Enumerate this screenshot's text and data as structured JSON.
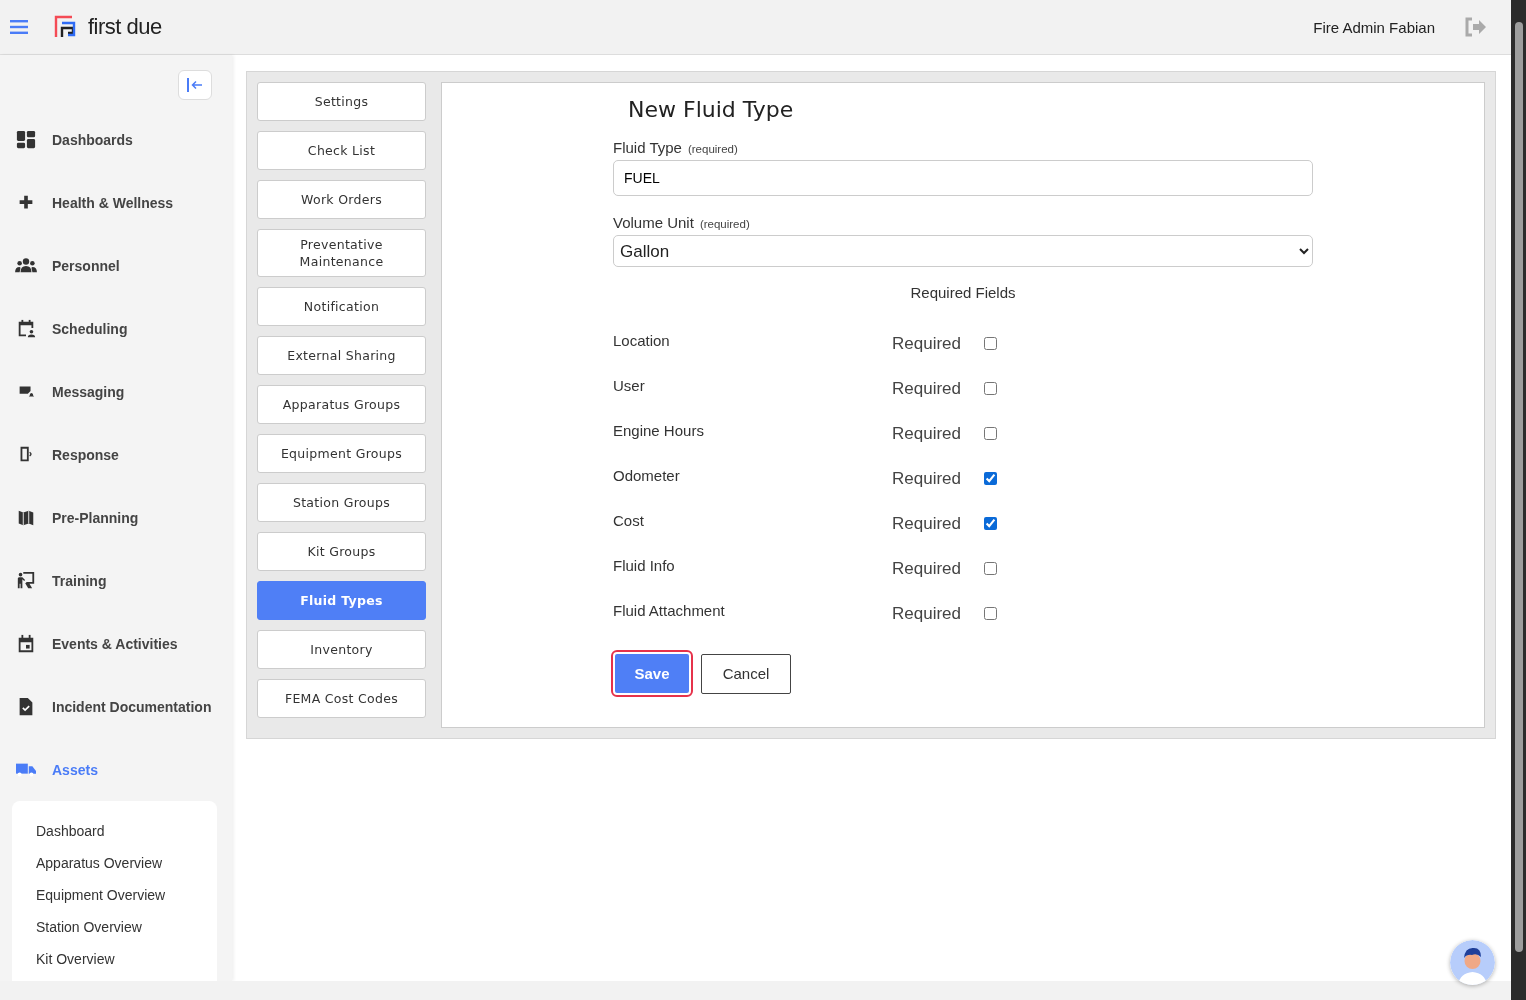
{
  "header": {
    "brand": "first due",
    "user": "Fire Admin Fabian"
  },
  "sidebar": {
    "items": [
      {
        "label": "Dashboards",
        "selected": false
      },
      {
        "label": "Health & Wellness",
        "selected": false
      },
      {
        "label": "Personnel",
        "selected": false
      },
      {
        "label": "Scheduling",
        "selected": false
      },
      {
        "label": "Messaging",
        "selected": false
      },
      {
        "label": "Response",
        "selected": false
      },
      {
        "label": "Pre-Planning",
        "selected": false
      },
      {
        "label": "Training",
        "selected": false
      },
      {
        "label": "Events & Activities",
        "selected": false
      },
      {
        "label": "Incident Documentation",
        "selected": false
      },
      {
        "label": "Assets",
        "selected": true
      }
    ],
    "subitems": [
      "Dashboard",
      "Apparatus Overview",
      "Equipment Overview",
      "Station Overview",
      "Kit Overview"
    ]
  },
  "settings_nav": [
    {
      "label": "Settings",
      "selected": false
    },
    {
      "label": "Check List",
      "selected": false
    },
    {
      "label": "Work Orders",
      "selected": false
    },
    {
      "label": "Preventative Maintenance",
      "selected": false
    },
    {
      "label": "Notification",
      "selected": false
    },
    {
      "label": "External Sharing",
      "selected": false
    },
    {
      "label": "Apparatus Groups",
      "selected": false
    },
    {
      "label": "Equipment Groups",
      "selected": false
    },
    {
      "label": "Station Groups",
      "selected": false
    },
    {
      "label": "Kit Groups",
      "selected": false
    },
    {
      "label": "Fluid Types",
      "selected": true
    },
    {
      "label": "Inventory",
      "selected": false
    },
    {
      "label": "FEMA Cost Codes",
      "selected": false
    }
  ],
  "form": {
    "title": "New Fluid Type",
    "fluid_type": {
      "label": "Fluid Type",
      "hint": "(required)",
      "value": "FUEL"
    },
    "volume_unit": {
      "label": "Volume Unit",
      "hint": "(required)",
      "value": "Gallon"
    },
    "required_fields_heading": "Required Fields",
    "required_fields": [
      {
        "label": "Location",
        "text": "Required",
        "checked": false
      },
      {
        "label": "User",
        "text": "Required",
        "checked": false
      },
      {
        "label": "Engine Hours",
        "text": "Required",
        "checked": false
      },
      {
        "label": "Odometer",
        "text": "Required",
        "checked": true
      },
      {
        "label": "Cost",
        "text": "Required",
        "checked": true
      },
      {
        "label": "Fluid Info",
        "text": "Required",
        "checked": false
      },
      {
        "label": "Fluid Attachment",
        "text": "Required",
        "checked": false
      }
    ],
    "save": "Save",
    "cancel": "Cancel"
  }
}
